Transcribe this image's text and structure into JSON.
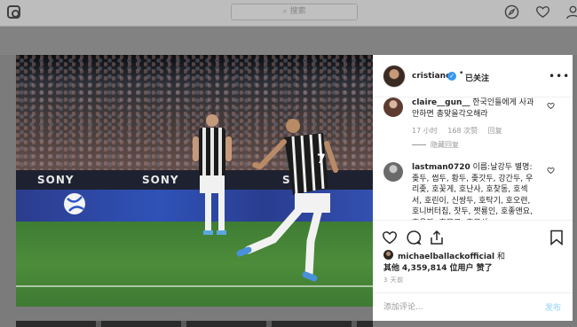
{
  "nav": {
    "search_placeholder": "搜索",
    "icons": [
      "instagram-logo-icon",
      "compass-icon",
      "heart-icon",
      "profile-icon"
    ]
  },
  "post": {
    "photo_board_texts": [
      "SONY",
      "SONY",
      "SONY"
    ],
    "author": {
      "username": "cristiano",
      "separator": "•",
      "follow_label": "已关注"
    },
    "comments": [
      {
        "username": "claire__gun__",
        "text": "한국인들에게 사과 안하면 총맞을각오해라",
        "time": "17 小时",
        "likes": "168 次赞",
        "reply_label": "回复",
        "hidden_replies_label": "隐藏回复"
      },
      {
        "username": "lastman0720",
        "text": "이름:날강두 별명:좆두, 썹두, 황두, 좆갓두, 강간두, 우리좆, 호꽃게, 호난사, 호찾동, 호섹서, 호린이, 신쌍두, 호탁기, 호오련, 호니버터칩, 찻두, 쩟룡인, 호좋앤요, 호우과, 호무고, 호무사"
      }
    ],
    "likes": {
      "liker": "michaelballackofficial",
      "and_label": "和",
      "others_prefix": "其他",
      "count": "4,359,814",
      "others_suffix": "位用户 赞了"
    },
    "time_ago": "3 天前",
    "add_comment_placeholder": "添加评论...",
    "post_button": "发布"
  },
  "colors": {
    "verified": "#3897f0",
    "post_button_disabled": "#b2dffc",
    "meta_text": "#999999"
  }
}
